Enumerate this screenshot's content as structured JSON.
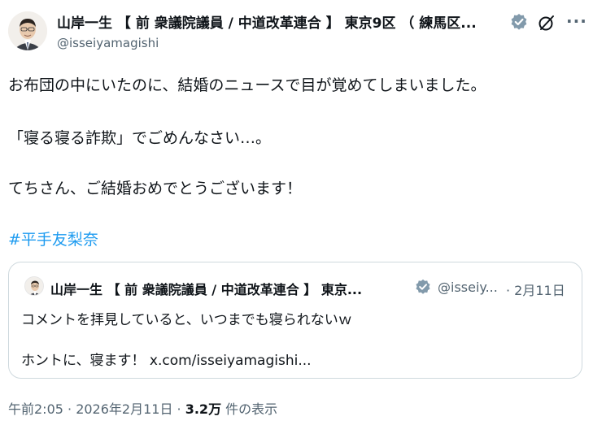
{
  "author": {
    "name": "山岸一生 【 前 衆議院議員 / 中道改革連合 】 東京9区 （ 練馬区...",
    "handle": "@isseiyamagishi",
    "more_label": "···"
  },
  "post": {
    "lines": [
      "お布団の中にいたのに、結婚のニュースで目が覚めてしまいました。",
      "「寝る寝る詐欺」でごめんなさい…。",
      "てちさん、ご結婚おめでとうございます！"
    ],
    "hashtag": "#平手友梨奈"
  },
  "quoted": {
    "name": "山岸一生 【 前 衆議院議員 / 中道改革連合 】 東京...",
    "handle": "@isseiy...",
    "date": "· 2月11日",
    "lines": [
      "コメントを拝見していると、いつまでも寝られないｗ",
      "ホントに、寝ます！ x.com/isseiyamagishi..."
    ]
  },
  "meta": {
    "time": "午前2:05 · 2026年2月11日 · ",
    "views_count": "3.2万",
    "views_label": " 件の表示"
  },
  "colors": {
    "accent": "#1d9bf0",
    "text": "#0f1419",
    "muted": "#536471",
    "border": "#cfd9de",
    "verified_gray": "#829aab"
  },
  "icons": {
    "verified": "verified-badge-icon",
    "grok": "grok-icon",
    "more": "more-icon"
  }
}
